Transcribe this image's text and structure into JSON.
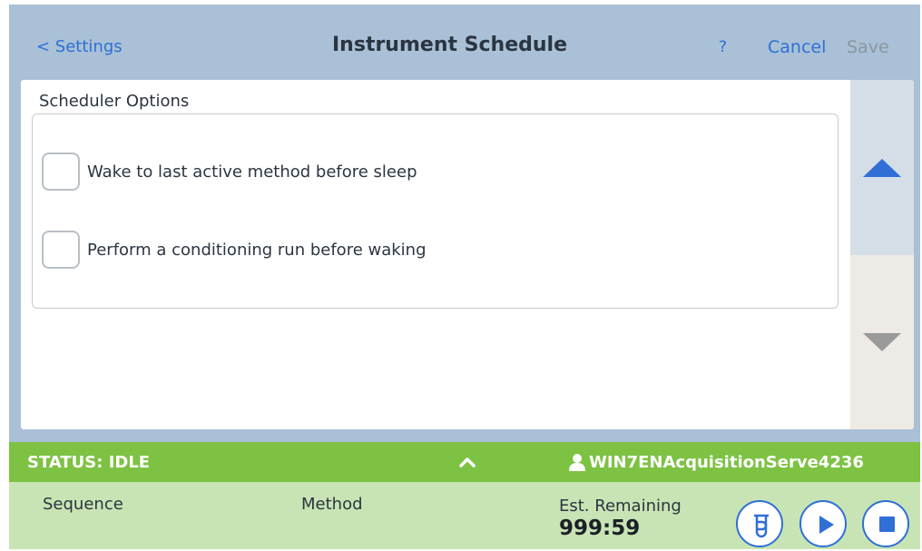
{
  "header": {
    "back_label": "< Settings",
    "title": "Instrument Schedule",
    "help_label": "?",
    "cancel_label": "Cancel",
    "save_label": "Save"
  },
  "scheduler": {
    "section_title": "Scheduler Options",
    "options": [
      {
        "label": "Wake to last active method before sleep",
        "checked": false
      },
      {
        "label": "Perform a conditioning run before waking",
        "checked": false
      }
    ]
  },
  "scroll": {
    "up_icon": "triangle-up-icon",
    "down_icon": "triangle-down-icon"
  },
  "status": {
    "text": "STATUS: IDLE",
    "expand_icon": "chevron-up-icon",
    "user_icon": "user-icon",
    "user": "WIN7ENAcquisitionServe4236"
  },
  "info": {
    "sequence_label": "Sequence",
    "method_label": "Method",
    "est_label": "Est. Remaining",
    "est_value": "999:59"
  },
  "controls": {
    "vial_icon": "vial-icon",
    "play_icon": "play-icon",
    "stop_icon": "stop-icon"
  },
  "colors": {
    "accent": "#2f6fd6",
    "status_green": "#7dc243",
    "info_green": "#c9e4b4",
    "header_bg": "#a9c0d6"
  }
}
